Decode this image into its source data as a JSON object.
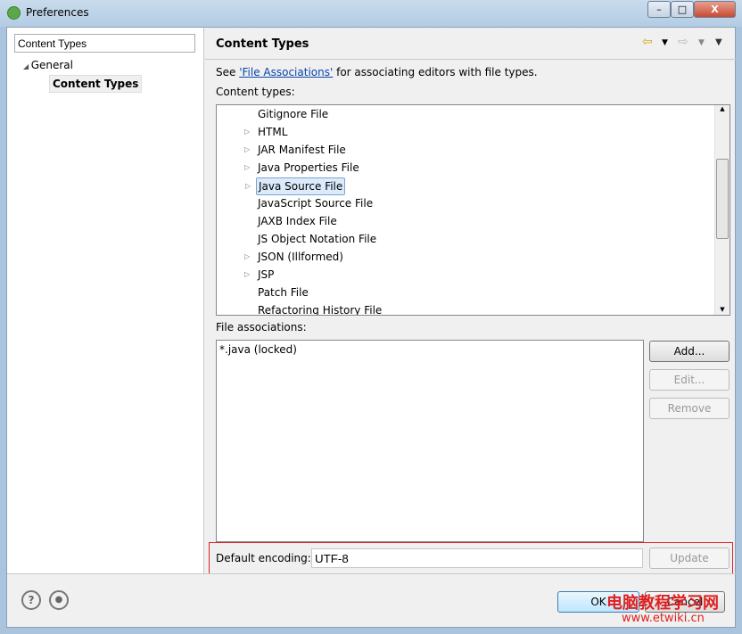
{
  "window": {
    "title": "Preferences",
    "min": "–",
    "max": "□",
    "close": "X"
  },
  "sidebar": {
    "filter_value": "Content Types",
    "general": "General",
    "content_types": "Content Types"
  },
  "page": {
    "title": "Content Types",
    "see_prefix": "See ",
    "link": "'File Associations'",
    "see_suffix": " for associating editors with file types.",
    "content_types_label": "Content types:",
    "types": [
      {
        "label": "Gitignore File",
        "expandable": false
      },
      {
        "label": "HTML",
        "expandable": true
      },
      {
        "label": "JAR Manifest File",
        "expandable": true
      },
      {
        "label": "Java Properties File",
        "expandable": true
      },
      {
        "label": "Java Source File",
        "expandable": true,
        "selected": true
      },
      {
        "label": "JavaScript Source File",
        "expandable": false
      },
      {
        "label": "JAXB Index File",
        "expandable": false
      },
      {
        "label": "JS Object Notation File",
        "expandable": false
      },
      {
        "label": "JSON (Illformed)",
        "expandable": true
      },
      {
        "label": "JSP",
        "expandable": true
      },
      {
        "label": "Patch File",
        "expandable": false
      },
      {
        "label": "Refactoring History File",
        "expandable": false
      }
    ],
    "file_assoc_label": "File associations:",
    "file_assoc": [
      "*.java (locked)"
    ],
    "add": "Add...",
    "edit": "Edit...",
    "remove": "Remove",
    "encoding_label": "Default encoding:",
    "encoding_value": "UTF-8",
    "update": "Update"
  },
  "footer": {
    "help": "?",
    "ok": "OK",
    "cancel": "Cancel"
  },
  "watermark": {
    "line1": "电脑教程学习网",
    "line2": "www.etwiki.cn"
  }
}
